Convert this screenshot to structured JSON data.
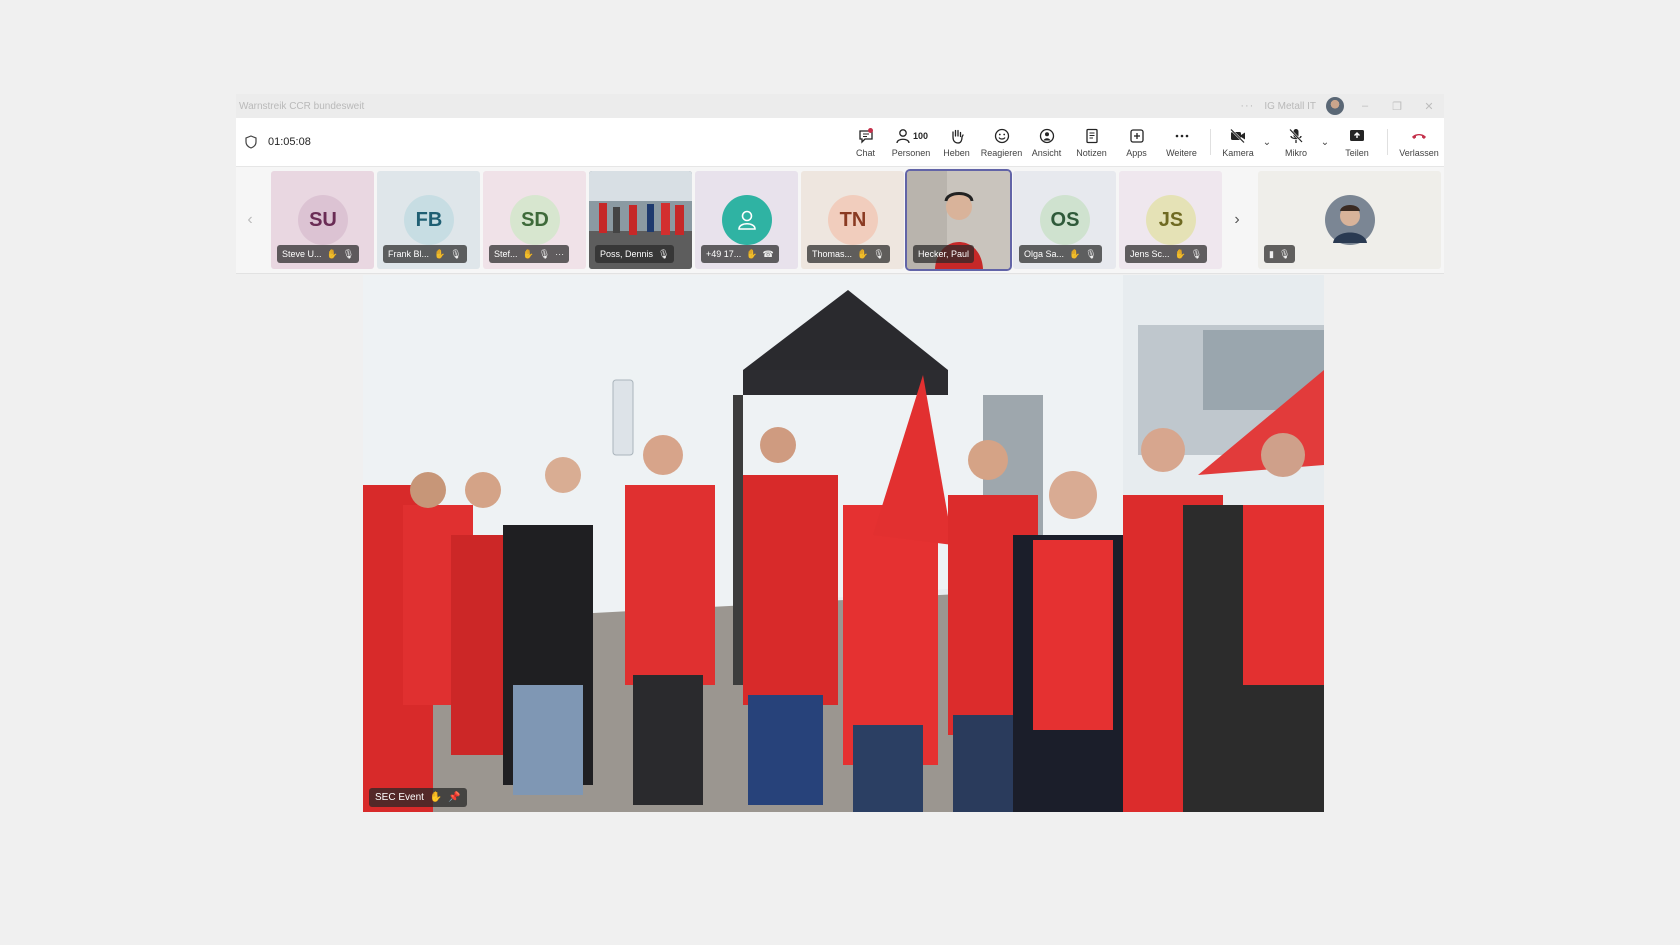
{
  "window": {
    "title": "Warnstreik CCR bundesweit",
    "more_label": "···",
    "org": "IG Metall IT"
  },
  "meeting": {
    "timer": "01:05:08"
  },
  "toolbar": {
    "chat": "Chat",
    "people": "Personen",
    "people_count": "100",
    "raise": "Heben",
    "react": "Reagieren",
    "view": "Ansicht",
    "notes": "Notizen",
    "apps": "Apps",
    "more": "Weitere",
    "camera": "Kamera",
    "mic": "Mikro",
    "share": "Teilen",
    "leave": "Verlassen"
  },
  "participants": [
    {
      "initials": "SU",
      "name": "Steve U...",
      "bg": "#e9d7e1",
      "fg": "#6a2c55",
      "circle": "#dcc3d3"
    },
    {
      "initials": "FB",
      "name": "Frank Bl...",
      "bg": "#dfe6ea",
      "fg": "#1f5f73",
      "circle": "#c7dde3"
    },
    {
      "initials": "SD",
      "name": "Stef...",
      "bg": "#f0e2e8",
      "fg": "#3e6a3a",
      "circle": "#d7e6cf"
    },
    {
      "initials": "",
      "name": "Poss, Dennis",
      "bg": "#7a8a90",
      "fg": "#ffffff",
      "circle": ""
    },
    {
      "initials": "",
      "name": "+49 17...",
      "bg": "#e8e2ec",
      "fg": "#ffffff",
      "circle": "#2fb3a3"
    },
    {
      "initials": "TN",
      "name": "Thomas...",
      "bg": "#eee6df",
      "fg": "#8a3a22",
      "circle": "#f1cdbd"
    },
    {
      "initials": "",
      "name": "Hecker, Paul",
      "bg": "#c9c4bd",
      "fg": "#ffffff",
      "circle": ""
    },
    {
      "initials": "OS",
      "name": "Olga Sa...",
      "bg": "#e7e9ee",
      "fg": "#2f5a3a",
      "circle": "#cfe2cf"
    },
    {
      "initials": "JS",
      "name": "Jens Sc...",
      "bg": "#efe7ee",
      "fg": "#6f6a22",
      "circle": "#e5e2b6"
    }
  ],
  "main_video": {
    "label": "SEC Event"
  }
}
